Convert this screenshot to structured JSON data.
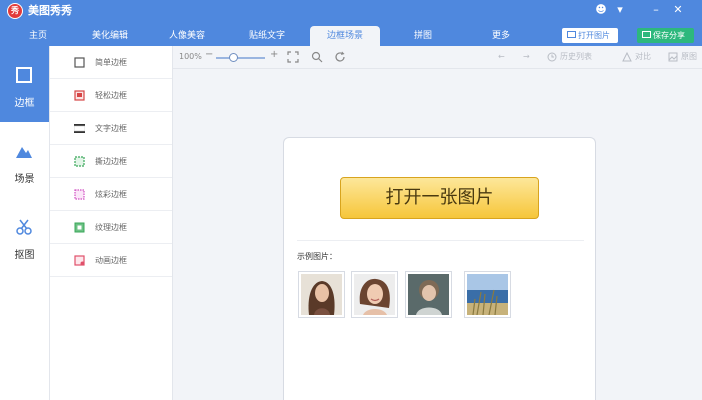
{
  "app": {
    "logo_text": "秀",
    "title": "美图秀秀"
  },
  "window_controls": {
    "feedback": "☻",
    "menu": "▾",
    "minimize": "–",
    "close": "✕"
  },
  "tabs": [
    {
      "label": "主页"
    },
    {
      "label": "美化编辑"
    },
    {
      "label": "人像美容"
    },
    {
      "label": "贴纸文字"
    },
    {
      "label": "边框场景",
      "active": true
    },
    {
      "label": "拼图"
    },
    {
      "label": "更多"
    }
  ],
  "header_buttons": {
    "open_image": "打开图片",
    "save_share": "保存分享"
  },
  "leftnav": [
    {
      "label": "边框",
      "icon": "frame-icon",
      "active": true
    },
    {
      "label": "场景",
      "icon": "scene-icon"
    },
    {
      "label": "抠图",
      "icon": "scissors-icon"
    }
  ],
  "submenu": [
    {
      "label": "简单边框",
      "icon": "simple-frame-icon",
      "color": "#555555"
    },
    {
      "label": "轻松边框",
      "icon": "easy-frame-icon",
      "color": "#d64545"
    },
    {
      "label": "文字边框",
      "icon": "text-frame-icon",
      "color": "#333333"
    },
    {
      "label": "撕边边框",
      "icon": "torn-frame-icon",
      "color": "#3aa75a"
    },
    {
      "label": "炫彩边框",
      "icon": "colorful-frame-icon",
      "color": "#d04fc2"
    },
    {
      "label": "纹理边框",
      "icon": "texture-frame-icon",
      "color": "#3aa75a"
    },
    {
      "label": "动画边框",
      "icon": "animation-frame-icon",
      "color": "#e0506a"
    }
  ],
  "toolbar": {
    "zoom": "100%",
    "zoom_out": "−",
    "zoom_in": "+",
    "zoom_level": 0.35,
    "undo": "←",
    "redo": "→",
    "history": "历史列表",
    "compare": "对比",
    "original": "原图"
  },
  "main": {
    "open_button": "打开一张图片",
    "sample_label": "示例图片："
  },
  "samples": [
    {
      "name": "woman-long-hair"
    },
    {
      "name": "woman-smiling"
    },
    {
      "name": "child-portrait"
    },
    {
      "name": "sea-grass"
    }
  ],
  "colors": {
    "header_blue": "#4f88de",
    "save_green": "#2db87d",
    "open_button_gold": "#f6c63a"
  }
}
